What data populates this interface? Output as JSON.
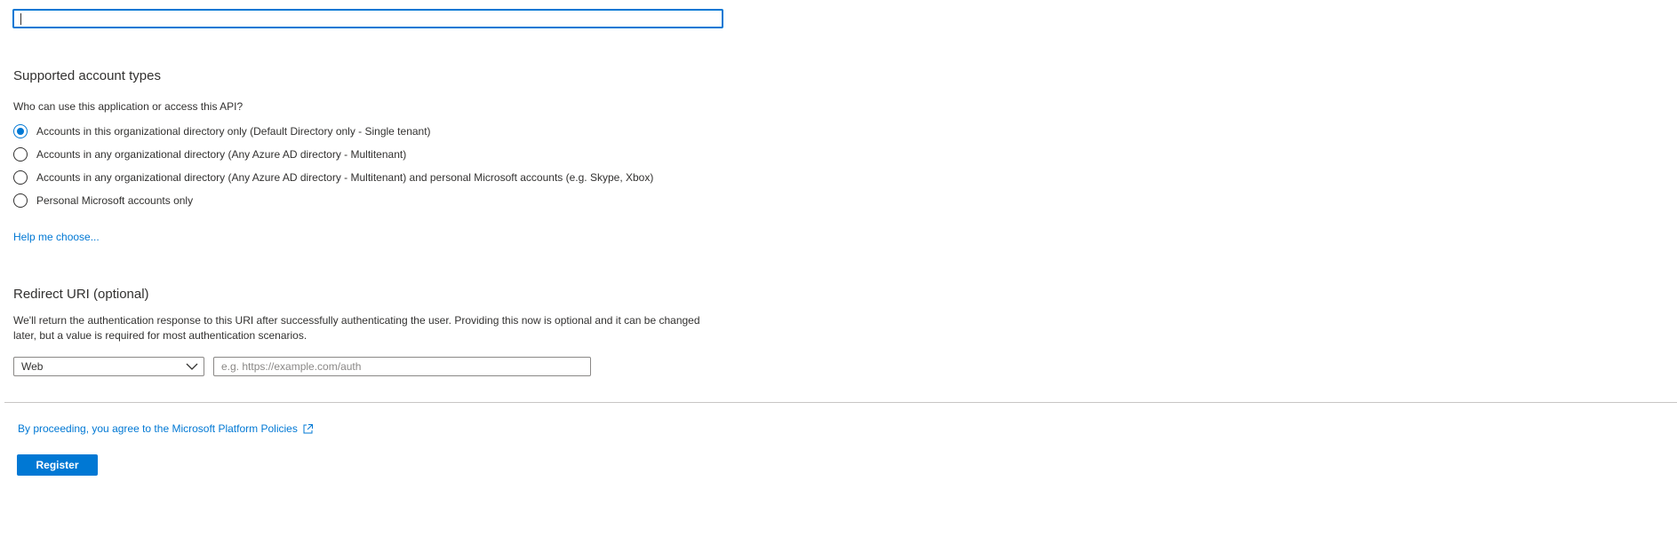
{
  "name_field": {
    "value": ""
  },
  "account_types": {
    "title": "Supported account types",
    "question": "Who can use this application or access this API?",
    "options": [
      {
        "label": "Accounts in this organizational directory only (Default Directory only - Single tenant)",
        "selected": true
      },
      {
        "label": "Accounts in any organizational directory (Any Azure AD directory - Multitenant)",
        "selected": false
      },
      {
        "label": "Accounts in any organizational directory (Any Azure AD directory - Multitenant) and personal Microsoft accounts (e.g. Skype, Xbox)",
        "selected": false
      },
      {
        "label": "Personal Microsoft accounts only",
        "selected": false
      }
    ],
    "help_link": "Help me choose..."
  },
  "redirect_uri": {
    "title": "Redirect URI (optional)",
    "description": "We'll return the authentication response to this URI after successfully authenticating the user. Providing this now is optional and it can be changed later, but a value is required for most authentication scenarios.",
    "platform_selected": "Web",
    "uri_placeholder": "e.g. https://example.com/auth",
    "uri_value": ""
  },
  "footer": {
    "policy_text": "By proceeding, you agree to the Microsoft Platform Policies",
    "register_label": "Register"
  },
  "colors": {
    "accent": "#0078d4",
    "text": "#323130",
    "border": "#8a8886",
    "divider": "#c8c6c4"
  }
}
